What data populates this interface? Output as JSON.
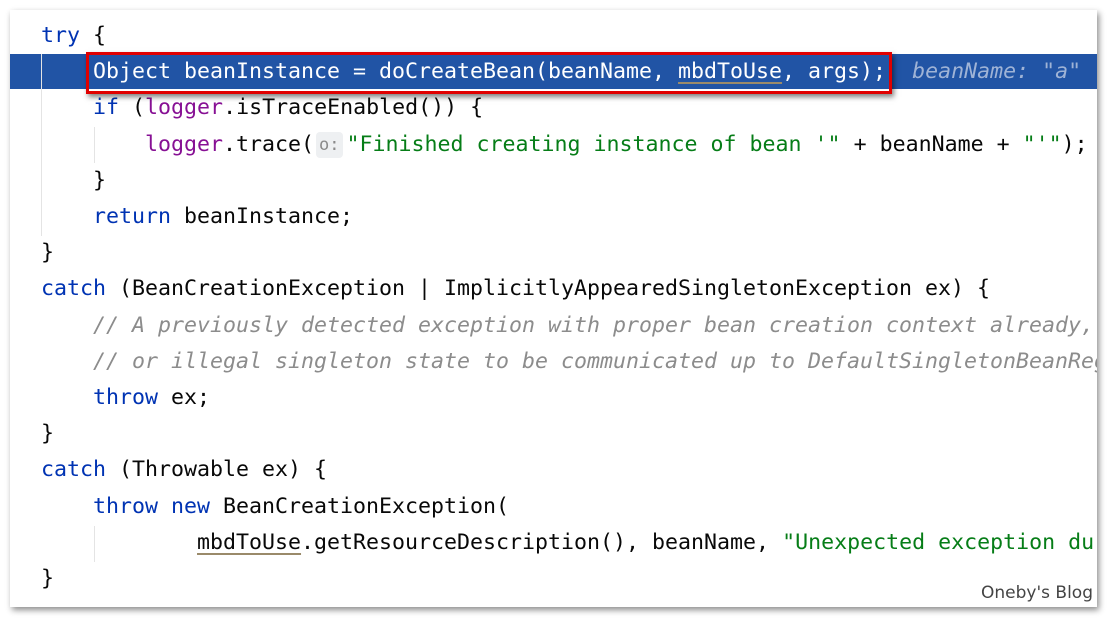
{
  "code": {
    "lines": [
      [
        {
          "t": "try",
          "c": "kw"
        },
        {
          "t": " {",
          "c": ""
        }
      ],
      [
        {
          "t": "    Object beanInstance = doCreateBean(beanName, ",
          "c": "sel"
        },
        {
          "t": "mbdToUse",
          "c": "sel ul"
        },
        {
          "t": ", args);",
          "c": "sel"
        },
        {
          "t": "  beanName: \"a\"",
          "c": "hint"
        }
      ],
      [
        {
          "t": "    ",
          "c": ""
        },
        {
          "t": "if",
          "c": "kw"
        },
        {
          "t": " (",
          "c": ""
        },
        {
          "t": "logger",
          "c": "pu"
        },
        {
          "t": ".isTraceEnabled()) {",
          "c": ""
        }
      ],
      [
        {
          "t": "        ",
          "c": ""
        },
        {
          "t": "logger",
          "c": "pu"
        },
        {
          "t": ".trace(",
          "c": ""
        },
        {
          "t": "o:",
          "c": "phint"
        },
        {
          "t": "\"Finished creating instance of bean '\"",
          "c": "st"
        },
        {
          "t": " + beanName + ",
          "c": ""
        },
        {
          "t": "\"'\"",
          "c": "st"
        },
        {
          "t": ");",
          "c": ""
        }
      ],
      [
        {
          "t": "    }",
          "c": ""
        }
      ],
      [
        {
          "t": "    ",
          "c": ""
        },
        {
          "t": "return",
          "c": "kw"
        },
        {
          "t": " beanInstance;",
          "c": ""
        }
      ],
      [
        {
          "t": "}",
          "c": ""
        }
      ],
      [
        {
          "t": "catch",
          "c": "kw"
        },
        {
          "t": " (BeanCreationException | ImplicitlyAppearedSingletonException ex) {",
          "c": ""
        }
      ],
      [
        {
          "t": "    // A previously detected exception with proper bean creation context already, ",
          "c": "cm"
        }
      ],
      [
        {
          "t": "    // or illegal singleton state to be communicated up to DefaultSingletonBeanRegistry.",
          "c": "cm"
        }
      ],
      [
        {
          "t": "    ",
          "c": ""
        },
        {
          "t": "throw",
          "c": "kw"
        },
        {
          "t": " ex;",
          "c": ""
        }
      ],
      [
        {
          "t": "}",
          "c": ""
        }
      ],
      [
        {
          "t": "catch",
          "c": "kw"
        },
        {
          "t": " (Throwable ex) {",
          "c": ""
        }
      ],
      [
        {
          "t": "    ",
          "c": ""
        },
        {
          "t": "throw new",
          "c": "kw"
        },
        {
          "t": " BeanCreationException(",
          "c": ""
        }
      ],
      [
        {
          "t": "            ",
          "c": ""
        },
        {
          "t": "mbdToUse",
          "c": "ul"
        },
        {
          "t": ".getResourceDescription(), beanName, ",
          "c": ""
        },
        {
          "t": "\"Unexpected exception during bean creation\"",
          "c": "st"
        }
      ],
      [
        {
          "t": "}",
          "c": ""
        }
      ]
    ]
  },
  "watermark": "Oneby's Blog",
  "colors": {
    "selection": "#2154a5",
    "highlight_box": "#e00000",
    "keyword": "#0033b3",
    "string": "#067d17",
    "field": "#871094",
    "comment": "#8c8c8c"
  }
}
